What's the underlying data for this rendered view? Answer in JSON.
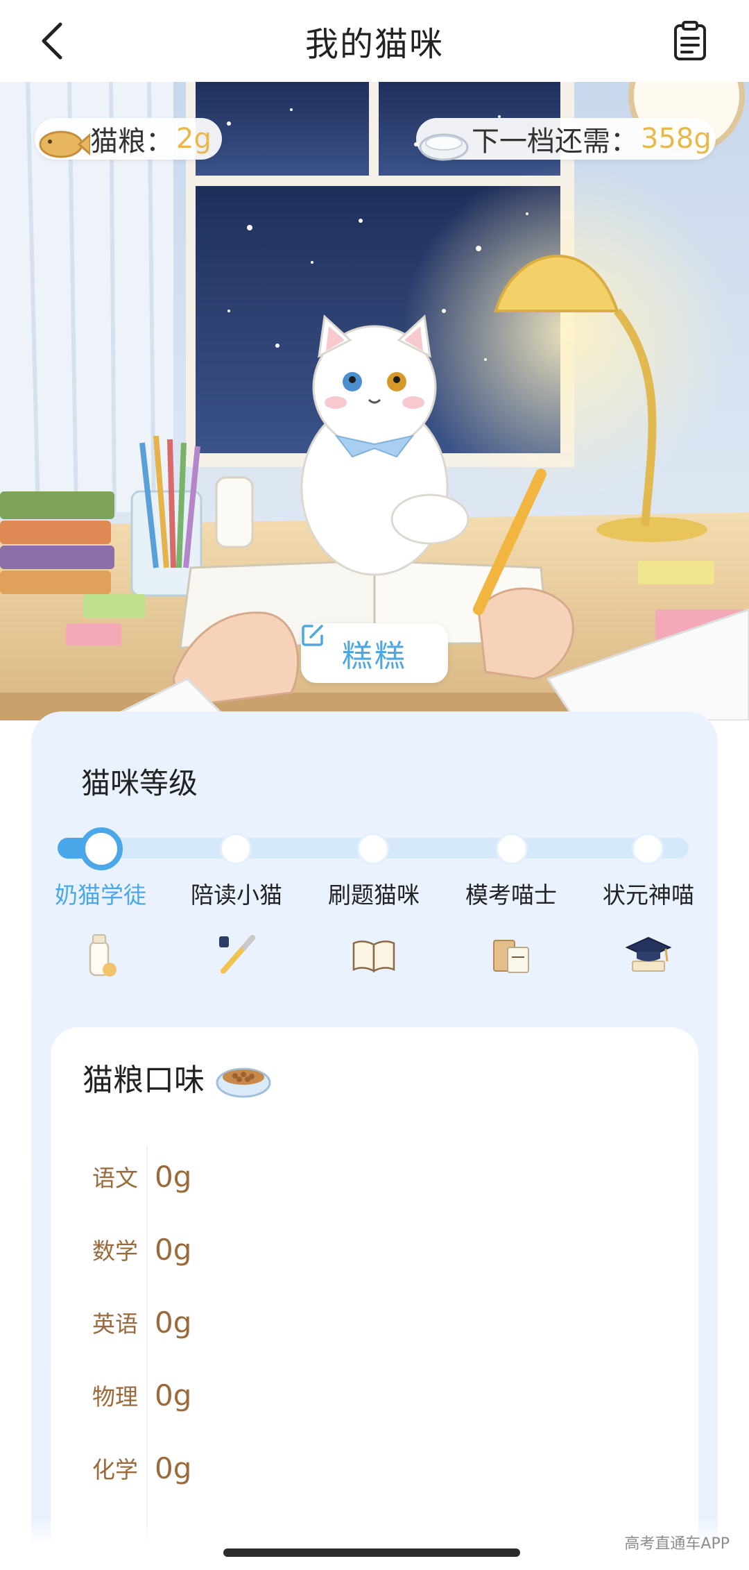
{
  "header": {
    "title": "我的猫咪",
    "back_icon": "chevron-left-icon",
    "right_icon": "clipboard-icon"
  },
  "hero": {
    "food_label": "猫粮：",
    "food_value": "2g",
    "next_label": "下一档还需：",
    "next_value": "358g",
    "cat_name": "糕糕",
    "edit_icon": "edit-icon"
  },
  "level": {
    "title": "猫咪等级",
    "progress": 0.0,
    "stages": [
      {
        "label": "奶猫学徒",
        "icon": "milk-bottle-icon",
        "active": true
      },
      {
        "label": "陪读小猫",
        "icon": "pen-icon",
        "active": false
      },
      {
        "label": "刷题猫咪",
        "icon": "open-book-icon",
        "active": false
      },
      {
        "label": "模考喵士",
        "icon": "paper-bag-icon",
        "active": false
      },
      {
        "label": "状元神喵",
        "icon": "graduation-cap-icon",
        "active": false
      }
    ]
  },
  "flavor": {
    "title": "猫粮口味",
    "icon": "food-bowl-icon",
    "rows": [
      {
        "subject": "语文",
        "amount": "0g"
      },
      {
        "subject": "数学",
        "amount": "0g"
      },
      {
        "subject": "英语",
        "amount": "0g"
      },
      {
        "subject": "物理",
        "amount": "0g"
      },
      {
        "subject": "化学",
        "amount": "0g"
      }
    ]
  },
  "watermark": "高考直通车APP",
  "colors": {
    "accent": "#4aa8e8",
    "gold": "#e9b84a",
    "brown": "#9a6a3a",
    "card_bg": "#eaf2ff"
  }
}
